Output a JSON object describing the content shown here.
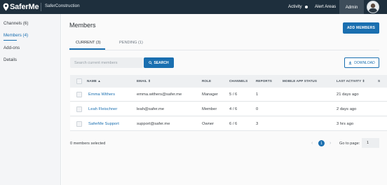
{
  "header": {
    "brand": "SaferMe",
    "org": "SaferConstruction",
    "nav": {
      "activity": "Activity",
      "alert_areas": "Alert Areas",
      "admin": "Admin"
    }
  },
  "sidebar": {
    "items": [
      {
        "label": "Channels (6)",
        "active": false
      },
      {
        "label": "Members (4)",
        "active": true
      },
      {
        "label": "Add-ons",
        "active": false
      },
      {
        "label": "Details",
        "active": false
      }
    ]
  },
  "main": {
    "title": "Members",
    "add_button": "ADD MEMBERS",
    "tabs": [
      {
        "label": "CURRENT (3)",
        "active": true
      },
      {
        "label": "PENDING (1)",
        "active": false
      }
    ],
    "search": {
      "placeholder": "Search current members",
      "value": "",
      "button": "SEARCH"
    },
    "download_button": "DOWNLOAD",
    "table": {
      "columns": [
        "NAME ▲",
        "EMAIL ⇕",
        "ROLE",
        "CHANNELS",
        "REPORTS",
        "MOBILE APP STATUS",
        "LAST ACTIVITY ⇕",
        "S"
      ],
      "rows": [
        {
          "name": "Emma Withers",
          "email": "emma.withers@safer.me",
          "role": "Manager",
          "channels": "5 / 6",
          "reports": "1",
          "mobile_status": "",
          "last_activity": "21 days ago"
        },
        {
          "name": "Leah Fleischner",
          "email": "leah@safer.me",
          "role": "Member",
          "channels": "4 / 6",
          "reports": "0",
          "mobile_status": "",
          "last_activity": "2 days ago"
        },
        {
          "name": "SaferMe Support",
          "email": "support@safer.me",
          "role": "Owner",
          "channels": "6 / 6",
          "reports": "3",
          "mobile_status": "",
          "last_activity": "3 hrs ago"
        }
      ]
    },
    "footer": {
      "selected": "0 members selected",
      "current_page": "1",
      "goto_label": "Go to page:",
      "goto_value": "1"
    }
  },
  "colors": {
    "topbar": "#1e2f3d",
    "accent": "#1a6fb0",
    "sidebar_bg": "#f4f5f7"
  },
  "icons": [
    "map-pin-icon",
    "activity-dot-icon",
    "avatar-icon",
    "search-icon",
    "download-icon",
    "chevron-left-icon",
    "chevron-right-icon"
  ]
}
